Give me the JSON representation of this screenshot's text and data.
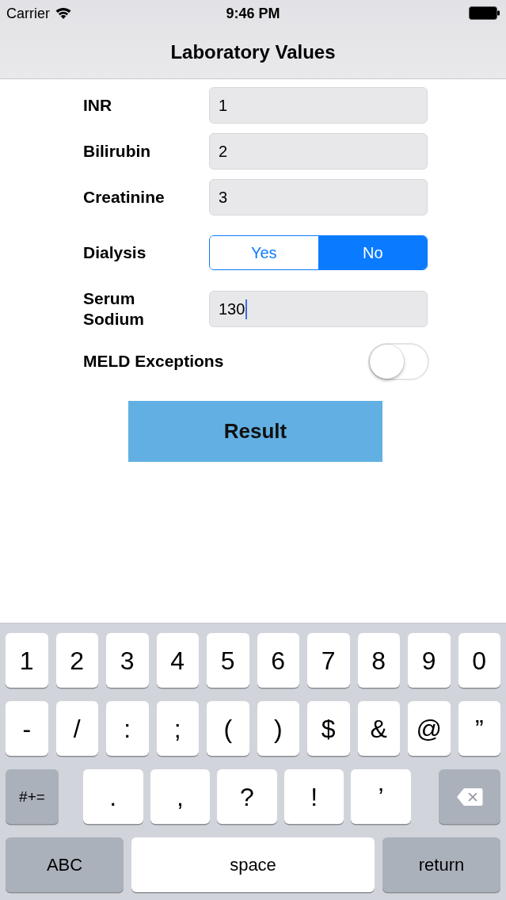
{
  "status_bar": {
    "carrier": "Carrier",
    "time": "9:46 PM"
  },
  "nav_bar": {
    "title": "Laboratory Values"
  },
  "form": {
    "rows": [
      {
        "kind": "text",
        "label": "INR",
        "value": "1",
        "focused": false
      },
      {
        "kind": "text",
        "label": "Bilirubin",
        "value": "2",
        "focused": false
      },
      {
        "kind": "text",
        "label": "Creatinine",
        "value": "3",
        "focused": false
      },
      {
        "kind": "segmented",
        "label": "Dialysis",
        "options": [
          {
            "label": "Yes",
            "selected": false
          },
          {
            "label": "No",
            "selected": true
          }
        ]
      },
      {
        "kind": "text",
        "label": "Serum Sodium",
        "value": "130",
        "focused": true
      },
      {
        "kind": "switch",
        "label": "MELD Exceptions",
        "on": false
      }
    ]
  },
  "result_button": {
    "label": "Result"
  },
  "keyboard": {
    "key_rows": [
      {
        "keys": [
          {
            "kind": "char",
            "label": "1"
          },
          {
            "kind": "char",
            "label": "2"
          },
          {
            "kind": "char",
            "label": "3"
          },
          {
            "kind": "char",
            "label": "4"
          },
          {
            "kind": "char",
            "label": "5"
          },
          {
            "kind": "char",
            "label": "6"
          },
          {
            "kind": "char",
            "label": "7"
          },
          {
            "kind": "char",
            "label": "8"
          },
          {
            "kind": "char",
            "label": "9"
          },
          {
            "kind": "char",
            "label": "0"
          }
        ]
      },
      {
        "keys": [
          {
            "kind": "char",
            "label": "-"
          },
          {
            "kind": "char",
            "label": "/"
          },
          {
            "kind": "char",
            "label": ":"
          },
          {
            "kind": "char",
            "label": ";"
          },
          {
            "kind": "char",
            "label": "("
          },
          {
            "kind": "char",
            "label": ")"
          },
          {
            "kind": "char",
            "label": "$"
          },
          {
            "kind": "char",
            "label": "&"
          },
          {
            "kind": "char",
            "label": "@"
          },
          {
            "kind": "char",
            "label": "”"
          }
        ]
      },
      {
        "keys": [
          {
            "kind": "function",
            "label": "#+="
          },
          {
            "kind": "char",
            "label": "."
          },
          {
            "kind": "char",
            "label": ","
          },
          {
            "kind": "char",
            "label": "?"
          },
          {
            "kind": "char",
            "label": "!"
          },
          {
            "kind": "char",
            "label": "’"
          },
          {
            "kind": "delete"
          }
        ]
      },
      {
        "keys": [
          {
            "kind": "function",
            "label": "ABC"
          },
          {
            "kind": "space",
            "label": "space"
          },
          {
            "kind": "function",
            "label": "return"
          }
        ]
      }
    ]
  }
}
